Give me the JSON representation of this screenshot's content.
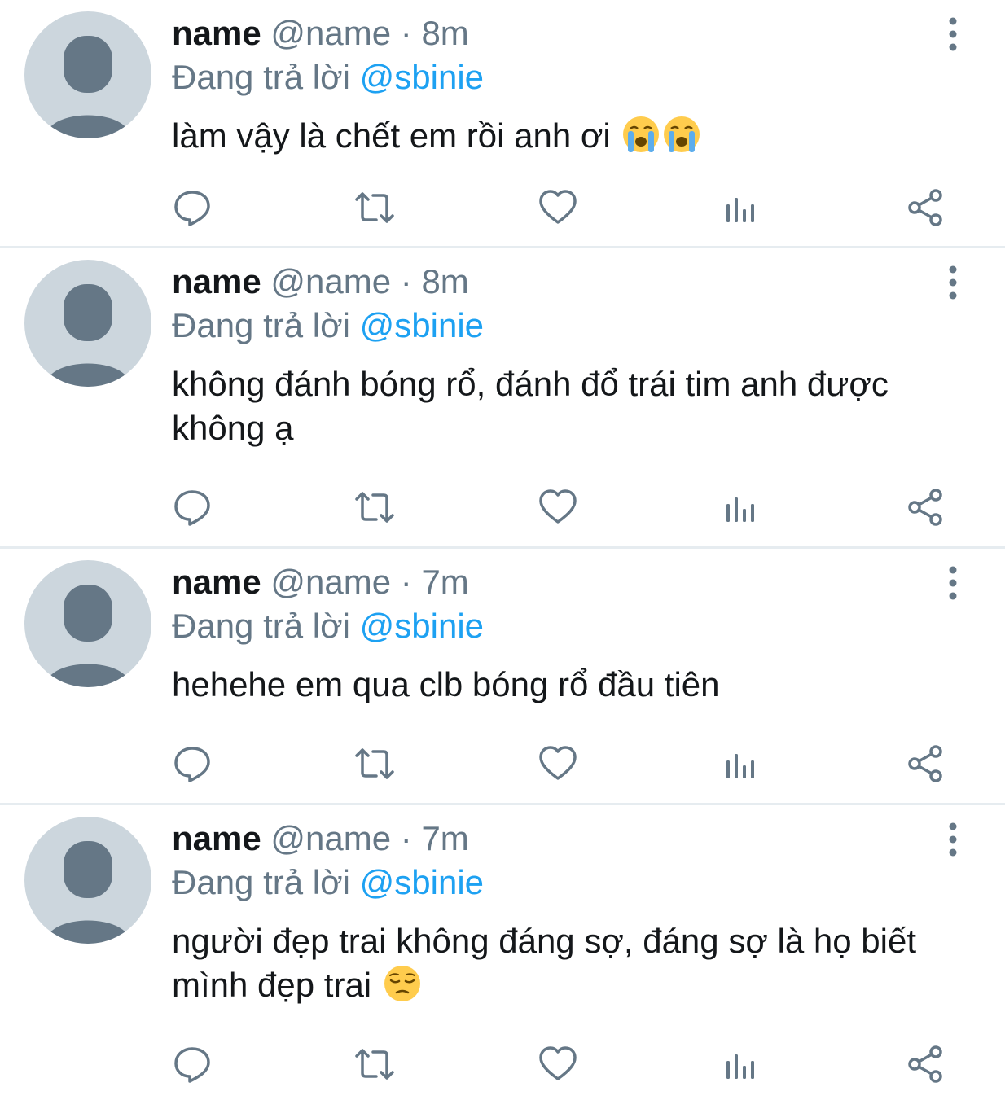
{
  "tweets": [
    {
      "display_name": "name",
      "handle": "@name",
      "separator": "·",
      "time": "8m",
      "reply_prefix": "Đang trả lời",
      "reply_to": "@sbinie",
      "text": "làm vậy là chết em rồi anh ơi",
      "emojis": [
        "loudly-crying-face",
        "loudly-crying-face"
      ]
    },
    {
      "display_name": "name",
      "handle": "@name",
      "separator": "·",
      "time": "8m",
      "reply_prefix": "Đang trả lời",
      "reply_to": "@sbinie",
      "text": "không đánh bóng rổ, đánh đổ trái tim anh được không ạ",
      "emojis": []
    },
    {
      "display_name": "name",
      "handle": "@name",
      "separator": "·",
      "time": "7m",
      "reply_prefix": "Đang trả lời",
      "reply_to": "@sbinie",
      "text": "hehehe em qua clb bóng rổ đầu tiên",
      "emojis": []
    },
    {
      "display_name": "name",
      "handle": "@name",
      "separator": "·",
      "time": "7m",
      "reply_prefix": "Đang trả lời",
      "reply_to": "@sbinie",
      "text": "người đẹp trai không đáng sợ, đáng sợ là họ biết mình đẹp trai",
      "emojis": [
        "pensive-face"
      ]
    }
  ],
  "icons": {
    "avatar": "default-avatar-icon",
    "more": "more-vertical-icon",
    "reply": "reply-icon",
    "retweet": "retweet-icon",
    "like": "heart-icon",
    "stats": "stats-icon",
    "share": "share-icon"
  },
  "colors": {
    "text": "#14171a",
    "secondary": "#657786",
    "link": "#1da1f2",
    "avatar_bg": "#ccd6dd",
    "avatar_fg": "#657786",
    "divider": "#e6ecf0"
  }
}
